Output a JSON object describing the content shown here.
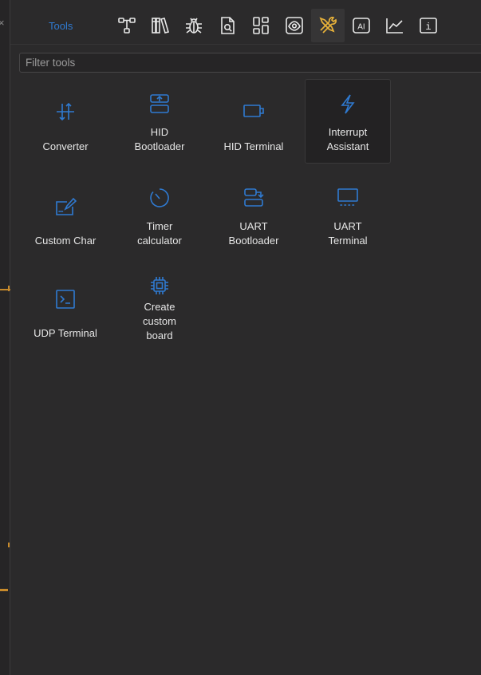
{
  "sidebar_edge": {
    "close_glyph": "×"
  },
  "header": {
    "title": "Tools",
    "tabs": [
      {
        "icon": "hierarchy-icon",
        "active": false
      },
      {
        "icon": "library-books-icon",
        "active": false
      },
      {
        "icon": "bug-icon",
        "active": false
      },
      {
        "icon": "document-search-icon",
        "active": false
      },
      {
        "icon": "grid-widgets-icon",
        "active": false
      },
      {
        "icon": "eye-camera-icon",
        "active": false
      },
      {
        "icon": "tools-wrench-icon",
        "active": true
      },
      {
        "icon": "ai-icon",
        "active": false
      },
      {
        "icon": "line-chart-icon",
        "active": false
      },
      {
        "icon": "info-icon",
        "active": false
      }
    ],
    "ai_label": "AI",
    "info_label": "i"
  },
  "filter": {
    "placeholder": "Filter tools",
    "value": ""
  },
  "tools": [
    {
      "label": "Converter",
      "icon": "converter-arrows-icon",
      "selected": false
    },
    {
      "label": "HID\nBootloader",
      "icon": "hid-bootloader-icon",
      "selected": false
    },
    {
      "label": "HID Terminal",
      "icon": "hid-terminal-icon",
      "selected": false
    },
    {
      "label": "Interrupt\nAssistant",
      "icon": "lightning-icon",
      "selected": true
    },
    {
      "label": "Custom Char",
      "icon": "custom-char-edit-icon",
      "selected": false
    },
    {
      "label": "Timer\ncalculator",
      "icon": "timer-icon",
      "selected": false
    },
    {
      "label": "UART\nBootloader",
      "icon": "uart-bootloader-icon",
      "selected": false
    },
    {
      "label": "UART\nTerminal",
      "icon": "uart-terminal-icon",
      "selected": false
    },
    {
      "label": "UDP Terminal",
      "icon": "udp-terminal-icon",
      "selected": false
    },
    {
      "label": "Create\ncustom\nboard",
      "icon": "chip-icon",
      "selected": false
    }
  ],
  "colors": {
    "accent_blue": "#2f7ad1",
    "active_tab_icon": "#e8b23a",
    "icon_white": "#e8e8e8",
    "background": "#2b2a2b",
    "edge_marker": "#c78a2b"
  }
}
